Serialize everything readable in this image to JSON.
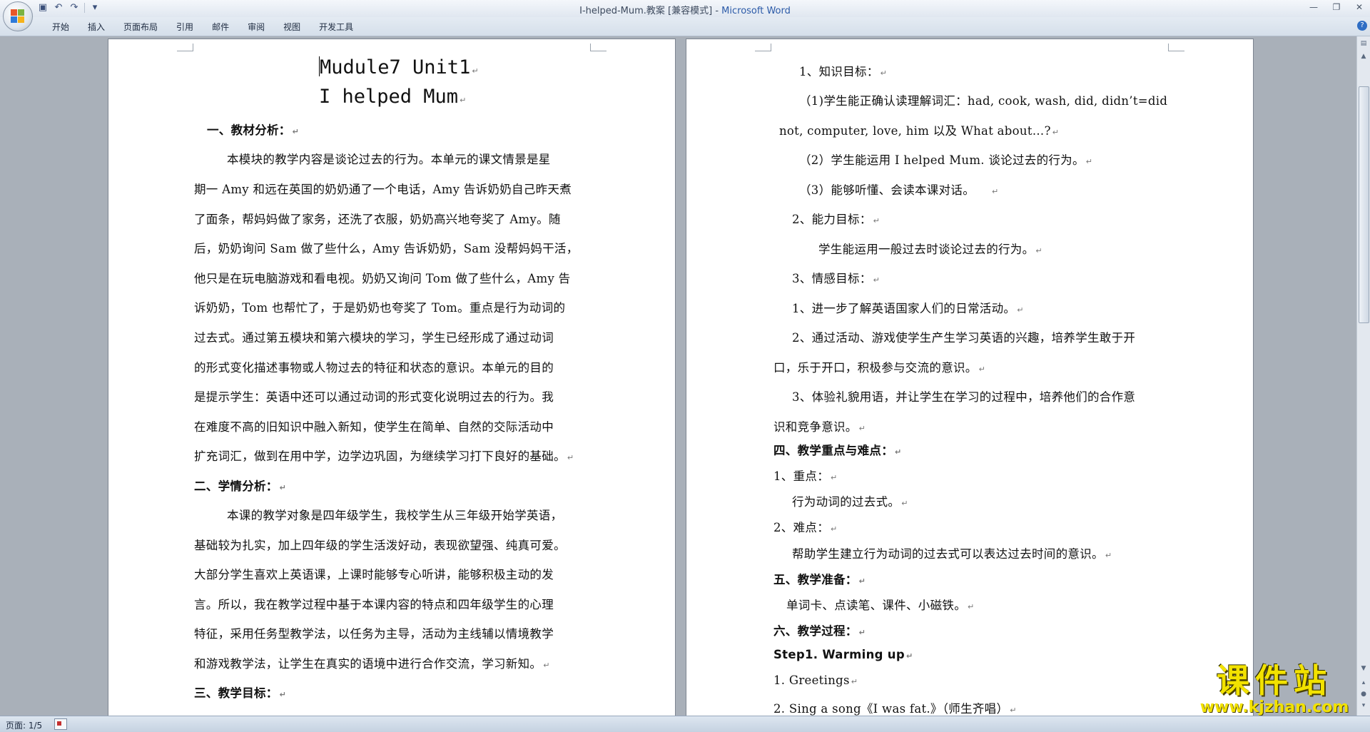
{
  "window": {
    "title": "I-helped-Mum.教案 [兼容模式] - ",
    "app_name": "Microsoft Word"
  },
  "qat": {
    "save_icon": "save-icon",
    "undo_icon": "undo-icon",
    "redo_icon": "redo-icon",
    "customize_icon": "customize-icon"
  },
  "ribbon": {
    "tabs": [
      "开始",
      "插入",
      "页面布局",
      "引用",
      "邮件",
      "审阅",
      "视图",
      "开发工具"
    ]
  },
  "status": {
    "page": "页面: 1/5"
  },
  "watermark": {
    "cn": "课件站",
    "url": "www.kjzhan.com"
  },
  "left_page": {
    "lines": [
      "Mudule7 Unit1",
      "I helped Mum",
      "一、教材分析：",
      "本模块的教学内容是谈论过去的行为。本单元的课文情景是星",
      "期一 Amy 和远在英国的奶奶通了一个电话，Amy 告诉奶奶自己昨天煮",
      "了面条，帮妈妈做了家务，还洗了衣服，奶奶高兴地夸奖了 Amy。随",
      "后，奶奶询问 Sam 做了些什么，Amy 告诉奶奶，Sam 没帮妈妈干活，",
      "他只是在玩电脑游戏和看电视。奶奶又询问 Tom 做了些什么，Amy 告",
      "诉奶奶，Tom 也帮忙了，于是奶奶也夸奖了 Tom。重点是行为动词的",
      "过去式。通过第五模块和第六模块的学习，学生已经形成了通过动词",
      "的形式变化描述事物或人物过去的特征和状态的意识。本单元的目的",
      "是提示学生：英语中还可以通过动词的形式变化说明过去的行为。我",
      "在难度不高的旧知识中融入新知，使学生在简单、自然的交际活动中",
      "扩充词汇，做到在用中学，边学边巩固，为继续学习打下良好的基础。",
      "二、学情分析：",
      "本课的教学对象是四年级学生，我校学生从三年级开始学英语，",
      "基础较为扎实，加上四年级的学生活泼好动，表现欲望强、纯真可爱。",
      "大部分学生喜欢上英语课，上课时能够专心听讲，能够积极主动的发",
      "言。所以，我在教学过程中基于本课内容的特点和四年级学生的心理",
      "特征，采用任务型教学法，以任务为主导，活动为主线辅以情境教学",
      "和游戏教学法，让学生在真实的语境中进行合作交流，学习新知。",
      "三、教学目标："
    ]
  },
  "right_page": {
    "lines": [
      "1、知识目标：",
      "（1)学生能正确认读理解词汇：had, cook, wash, did, didn’t=did",
      "not, computer, love, him 以及 What about…?",
      "（2）学生能运用 I helped Mum. 谈论过去的行为。",
      "（3）能够听懂、会读本课对话。",
      "2、能力目标：",
      "学生能运用一般过去时谈论过去的行为。",
      "3、情感目标：",
      "1、进一步了解英语国家人们的日常活动。",
      "2、通过活动、游戏使学生产生学习英语的兴趣，培养学生敢于开",
      "口，乐于开口，积极参与交流的意识。",
      "3、体验礼貌用语，并让学生在学习的过程中，培养他们的合作意",
      "识和竞争意识。",
      "四、教学重点与难点：",
      "1、重点：",
      "行为动词的过去式。",
      "2、难点：",
      "帮助学生建立行为动词的过去式可以表达过去时间的意识。",
      "五、教学准备：",
      "单词卡、点读笔、课件、小磁铁。",
      "六、教学过程：",
      "Step1. Warming up",
      "1. Greetings",
      "2. Sing a song《I was fat.》（师生齐唱）"
    ]
  }
}
